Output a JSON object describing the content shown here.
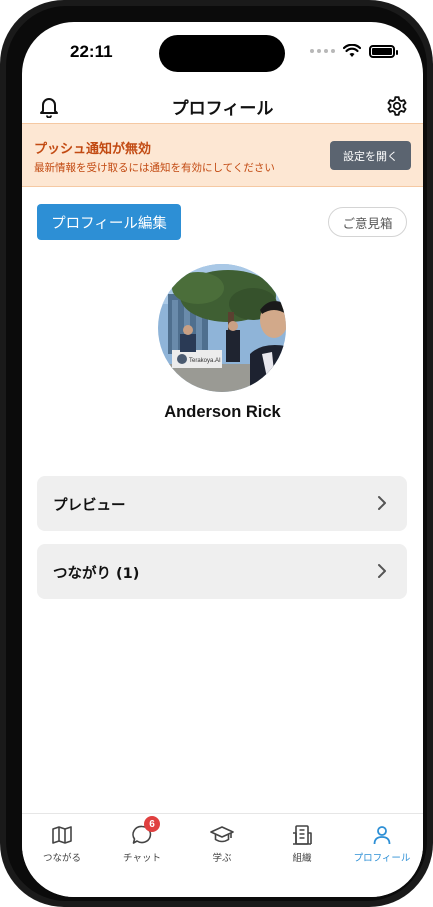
{
  "status_bar": {
    "time": "22:11"
  },
  "header": {
    "title": "プロフィール"
  },
  "banner": {
    "title": "プッシュ通知が無効",
    "subtitle": "最新情報を受け取るには通知を有効にしてください",
    "button_label": "設定を開く"
  },
  "actions": {
    "edit_profile": "プロフィール編集",
    "feedback": "ご意見箱"
  },
  "profile": {
    "name": "Anderson  Rick",
    "photo_sign_text": "Terakoya.AI"
  },
  "menu": [
    {
      "label": "プレビュー"
    },
    {
      "label": "つながり (1)"
    }
  ],
  "tabbar": {
    "tabs": [
      {
        "label": "つながる",
        "icon": "map-icon"
      },
      {
        "label": "チャット",
        "icon": "chat-icon",
        "badge": "6"
      },
      {
        "label": "学ぶ",
        "icon": "graduation-cap-icon"
      },
      {
        "label": "組織",
        "icon": "building-icon"
      },
      {
        "label": "プロフィール",
        "icon": "person-icon",
        "active": true
      }
    ]
  },
  "colors": {
    "accent": "#2d8fd5",
    "banner_bg": "#fde7d3",
    "banner_text": "#c24a12",
    "banner_button": "#5b6470",
    "badge": "#e04040"
  }
}
